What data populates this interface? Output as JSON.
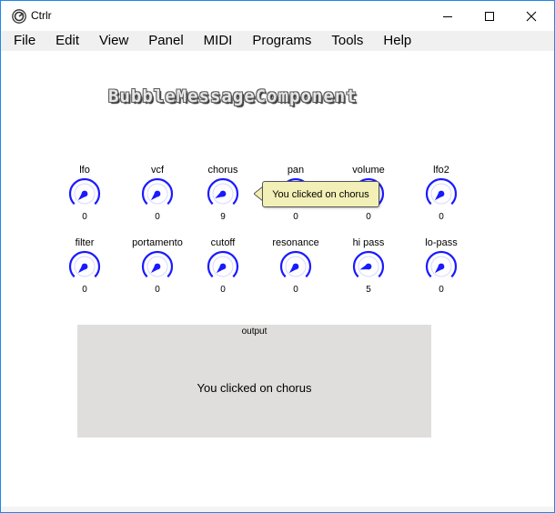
{
  "window": {
    "title": "Ctrlr",
    "accent_color": "#1e88e5",
    "controls": [
      "minimize-icon",
      "maximize-icon",
      "close-icon"
    ]
  },
  "menu": [
    "File",
    "Edit",
    "View",
    "Panel",
    "MIDI",
    "Programs",
    "Tools",
    "Help"
  ],
  "panel": {
    "title": "BubbleMessageComponent",
    "knob_color": "#1a1aff",
    "knobs": [
      {
        "label": "lfo",
        "value": "0"
      },
      {
        "label": "vcf",
        "value": "0"
      },
      {
        "label": "chorus",
        "value": "9"
      },
      {
        "label": "pan",
        "value": "0"
      },
      {
        "label": "volume",
        "value": "0"
      },
      {
        "label": "lfo2",
        "value": "0"
      },
      {
        "label": "filter",
        "value": "0"
      },
      {
        "label": "portamento",
        "value": "0"
      },
      {
        "label": "cutoff",
        "value": "0"
      },
      {
        "label": "resonance",
        "value": "0"
      },
      {
        "label": "hi pass",
        "value": "5"
      },
      {
        "label": "lo-pass",
        "value": "0"
      }
    ],
    "bubble": {
      "text": "You clicked on chorus",
      "color": "#f3f0b7"
    },
    "output": {
      "label": "output",
      "text": "You clicked on chorus",
      "color": "#e0dedd"
    }
  }
}
